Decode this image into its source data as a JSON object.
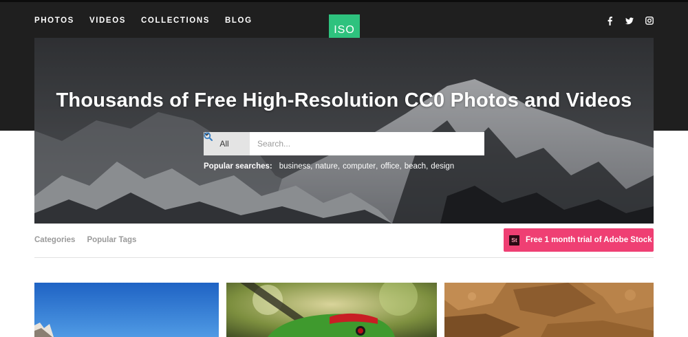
{
  "nav": {
    "items": [
      {
        "label": "PHOTOS"
      },
      {
        "label": "VIDEOS"
      },
      {
        "label": "COLLECTIONS"
      },
      {
        "label": "BLOG"
      }
    ]
  },
  "logo": {
    "text": "ISO"
  },
  "social": [
    {
      "icon": "facebook-icon"
    },
    {
      "icon": "twitter-icon"
    },
    {
      "icon": "instagram-icon"
    }
  ],
  "hero": {
    "title": "Thousands of Free High-Resolution CC0 Photos and Videos",
    "search": {
      "type_label": "All",
      "placeholder": "Search...",
      "value": ""
    },
    "popular": {
      "label": "Popular searches:",
      "terms": [
        "business",
        "nature",
        "computer",
        "office",
        "beach",
        "design"
      ]
    }
  },
  "subnav": {
    "items": [
      {
        "label": "Categories"
      },
      {
        "label": "Popular Tags"
      }
    ]
  },
  "promo": {
    "icon_text": "St",
    "label": "Free 1 month trial of Adobe Stock"
  },
  "colors": {
    "header_bg": "#1f1f1f",
    "logo_green": "#2ec27e",
    "promo_pink": "#ef3f73",
    "search_accent": "#3a7fc1"
  },
  "gallery": [
    {
      "subject": "mountain-sky-photo"
    },
    {
      "subject": "parrot-photo"
    },
    {
      "subject": "rock-texture-photo"
    }
  ]
}
